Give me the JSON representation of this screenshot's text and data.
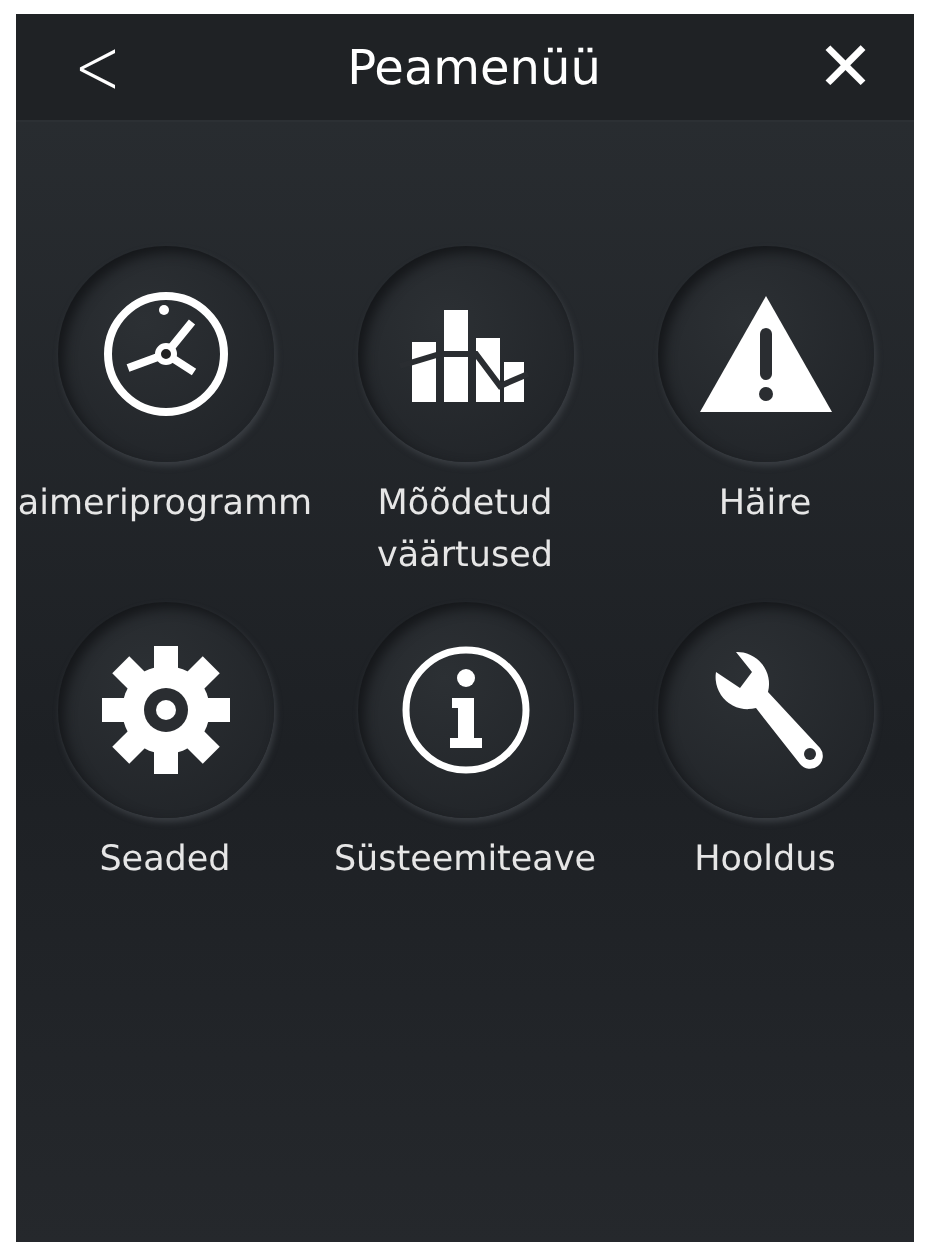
{
  "header": {
    "back": "<",
    "title": "Peamenüü",
    "close": "✕"
  },
  "items": [
    {
      "kind": "timer",
      "label": "aimeriprogramm"
    },
    {
      "kind": "chart",
      "label": "Mõõdetud väärtused"
    },
    {
      "kind": "warning",
      "label": "Häire"
    },
    {
      "kind": "gear",
      "label": "Seaded"
    },
    {
      "kind": "info",
      "label": "Süsteemiteave"
    },
    {
      "kind": "wrench",
      "label": "Hooldus"
    }
  ]
}
